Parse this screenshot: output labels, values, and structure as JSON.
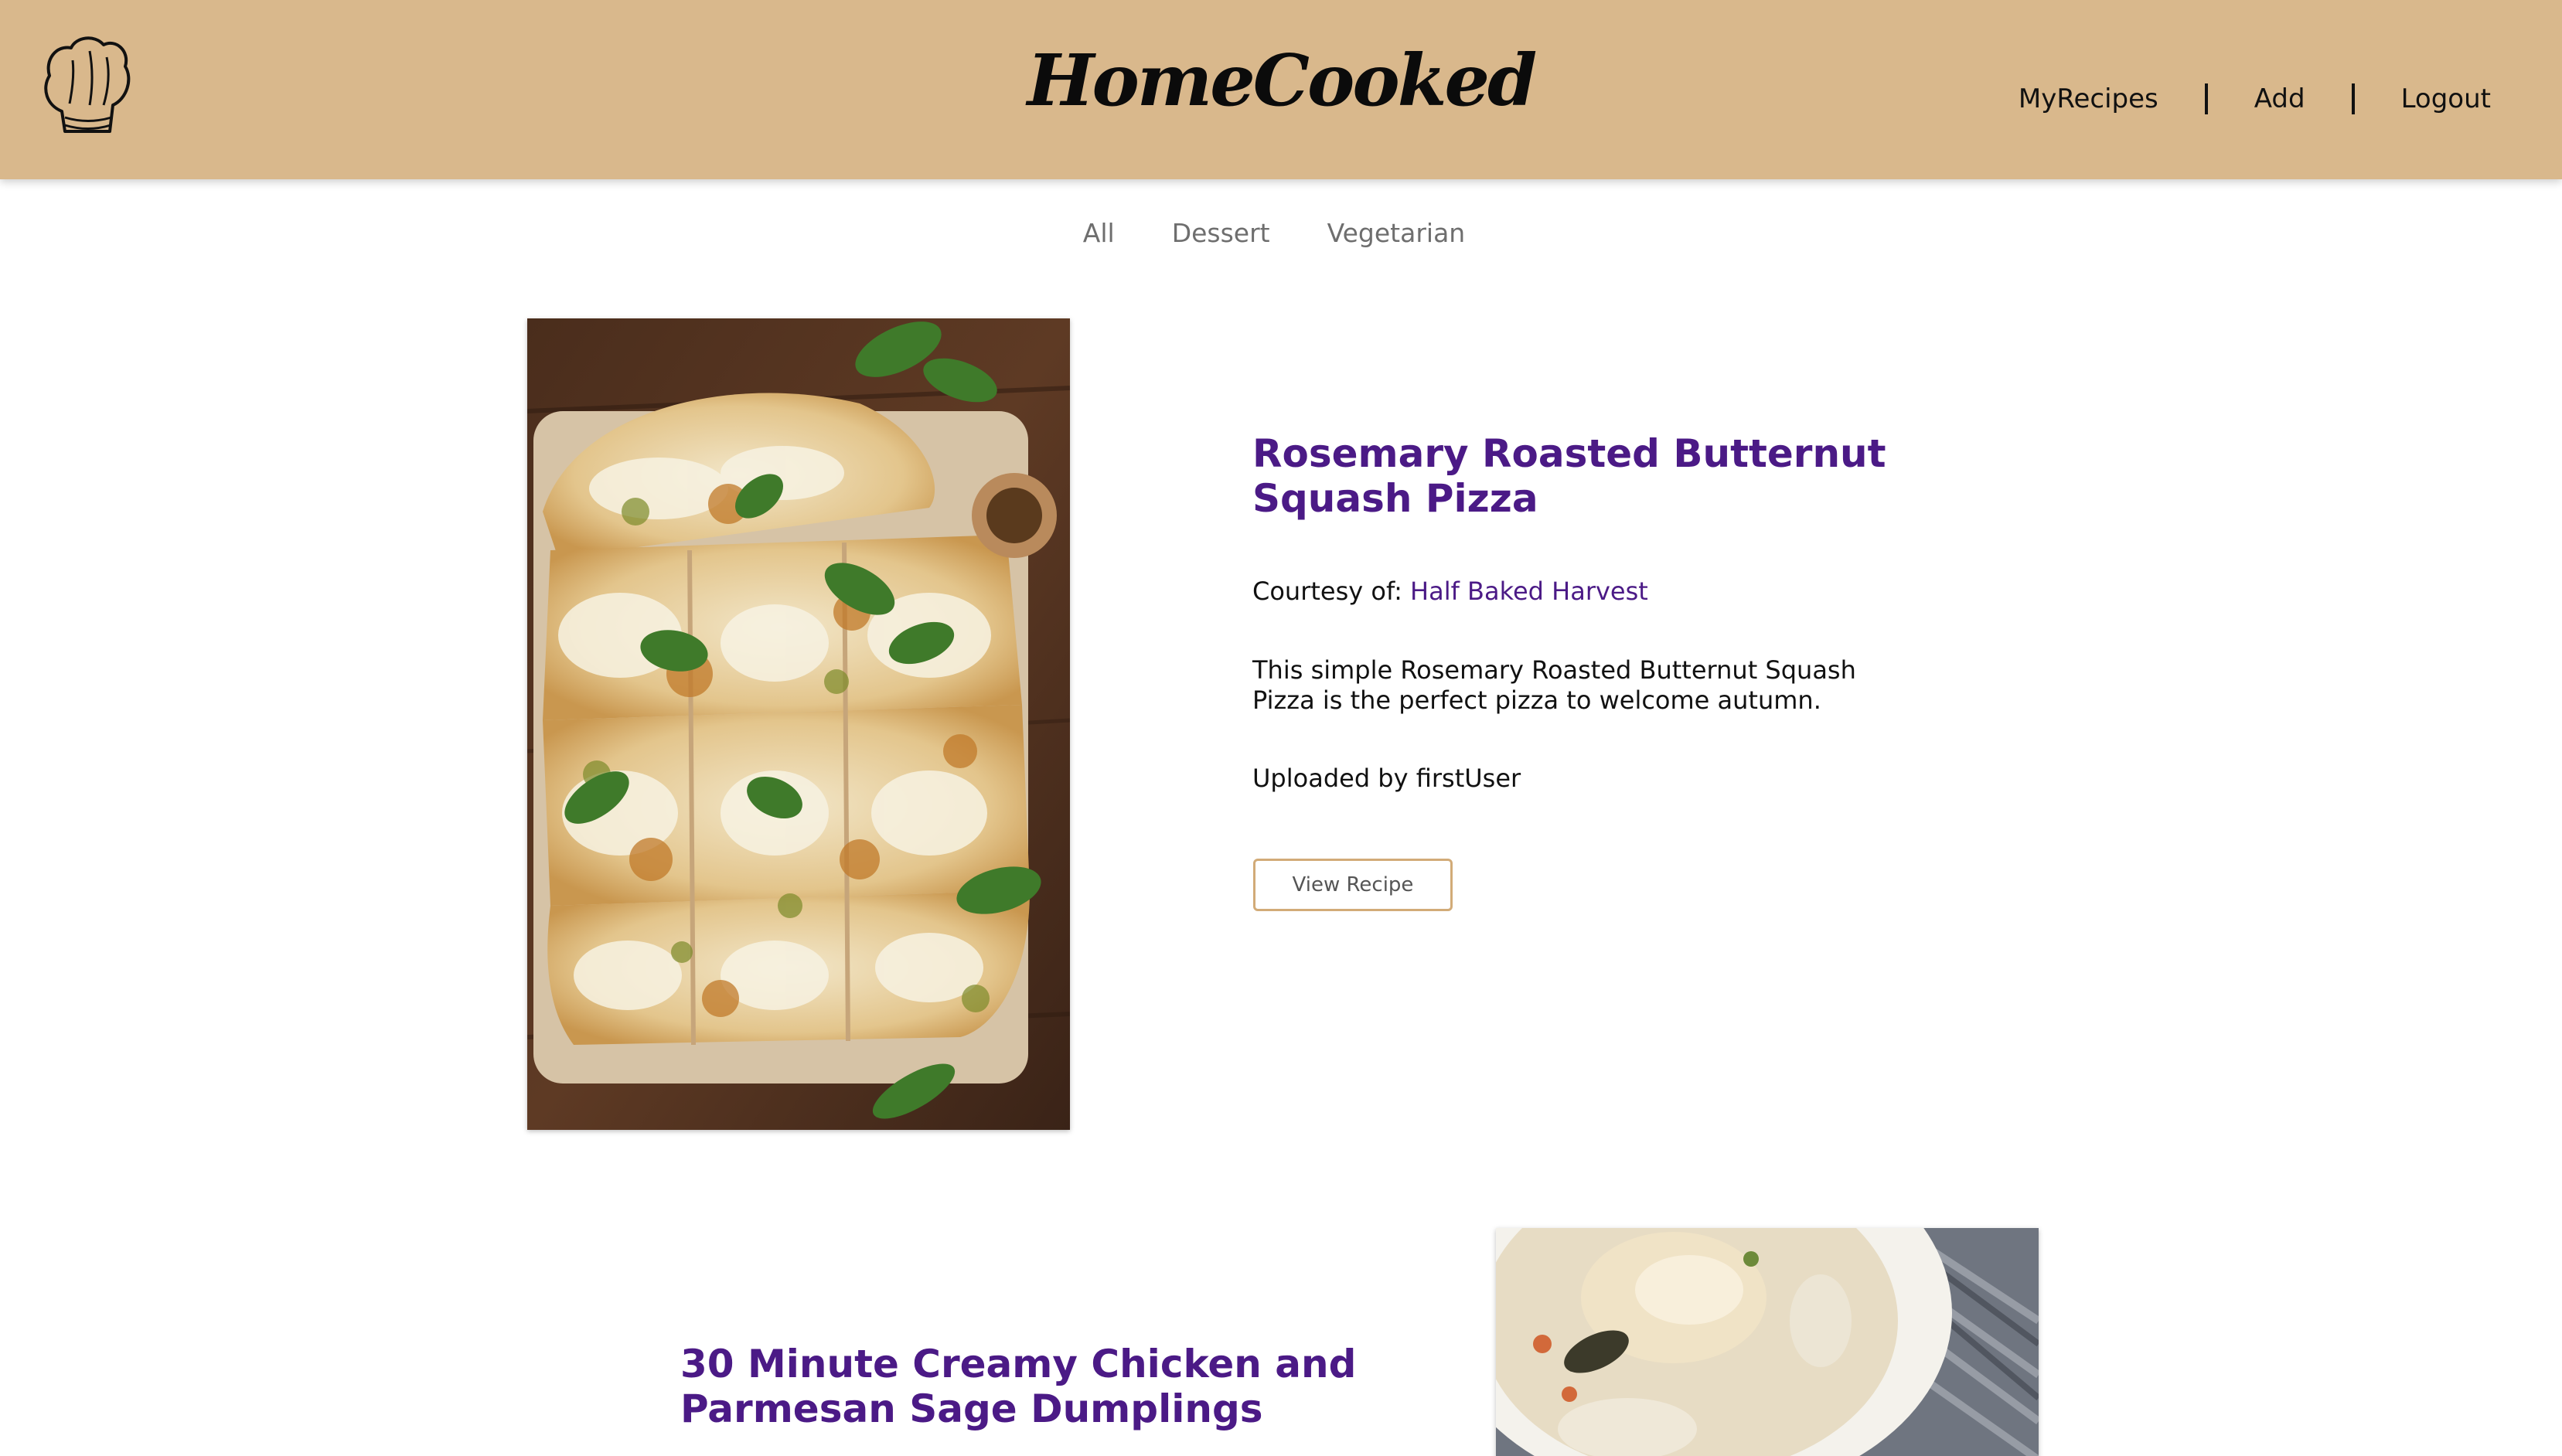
{
  "header": {
    "brand": "HomeCooked",
    "nav": {
      "my_recipes": "MyRecipes",
      "add": "Add",
      "logout": "Logout"
    },
    "background": "#d9b88c"
  },
  "categories": [
    "All",
    "Dessert",
    "Vegetarian"
  ],
  "recipes": [
    {
      "title": "Rosemary Roasted Butternut Squash Pizza",
      "courtesy_label": "Courtesy of:",
      "source": "Half Baked Harvest",
      "description": "This simple Rosemary Roasted Butternut Squash Pizza is the perfect pizza to welcome autumn.",
      "uploaded_by": "Uploaded by firstUser",
      "button_label": "View Recipe"
    },
    {
      "title": "30 Minute Creamy Chicken and Parmesan Sage Dumplings"
    }
  ],
  "accent_color": "#4b1a86"
}
